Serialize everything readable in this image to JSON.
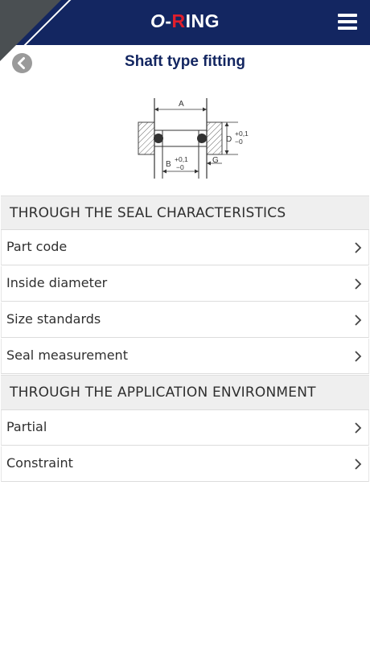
{
  "header": {
    "logo_o": "O",
    "logo_dash": "-",
    "logo_r": "R",
    "logo_rest": "ING",
    "menu_icon": "hamburger-menu-icon"
  },
  "page": {
    "title": "Shaft type fitting",
    "back_icon": "back-arrow-icon"
  },
  "diagram": {
    "label_a": "A",
    "label_b": "B",
    "label_d": "D",
    "label_g": "G",
    "tol_d_plus": "+0,1",
    "tol_d_minus": "−0",
    "tol_b_plus": "+0,1",
    "tol_b_minus": "−0"
  },
  "sections": [
    {
      "title": "THROUGH THE SEAL CHARACTERISTICS",
      "items": [
        {
          "label": "Part code"
        },
        {
          "label": "Inside diameter"
        },
        {
          "label": "Size standards"
        },
        {
          "label": "Seal measurement"
        }
      ]
    },
    {
      "title": "THROUGH THE APPLICATION ENVIRONMENT",
      "items": [
        {
          "label": "Partial"
        },
        {
          "label": "Constraint"
        }
      ]
    }
  ],
  "colors": {
    "header_bg": "#132661",
    "accent_red": "#e01e2c",
    "title_color": "#132661",
    "section_bg": "#efefef"
  }
}
